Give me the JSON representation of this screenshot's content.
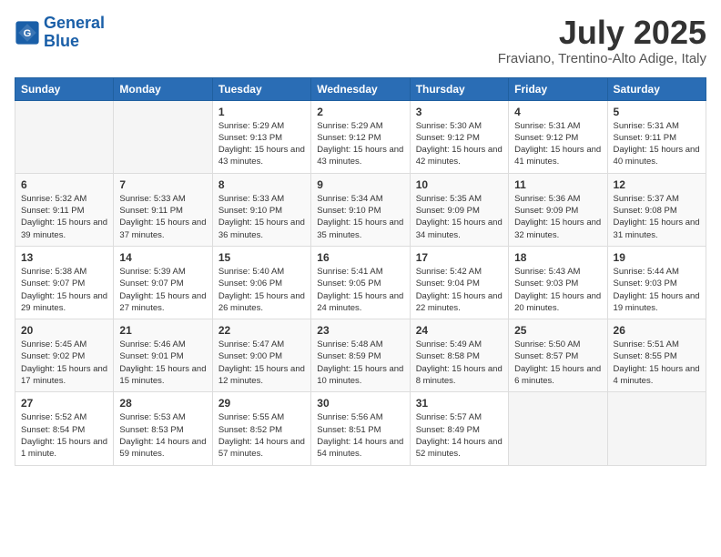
{
  "header": {
    "logo_general": "General",
    "logo_blue": "Blue",
    "month_year": "July 2025",
    "location": "Fraviano, Trentino-Alto Adige, Italy"
  },
  "columns": [
    "Sunday",
    "Monday",
    "Tuesday",
    "Wednesday",
    "Thursday",
    "Friday",
    "Saturday"
  ],
  "weeks": [
    [
      {
        "day": "",
        "info": ""
      },
      {
        "day": "",
        "info": ""
      },
      {
        "day": "1",
        "info": "Sunrise: 5:29 AM\nSunset: 9:13 PM\nDaylight: 15 hours\nand 43 minutes."
      },
      {
        "day": "2",
        "info": "Sunrise: 5:29 AM\nSunset: 9:12 PM\nDaylight: 15 hours\nand 43 minutes."
      },
      {
        "day": "3",
        "info": "Sunrise: 5:30 AM\nSunset: 9:12 PM\nDaylight: 15 hours\nand 42 minutes."
      },
      {
        "day": "4",
        "info": "Sunrise: 5:31 AM\nSunset: 9:12 PM\nDaylight: 15 hours\nand 41 minutes."
      },
      {
        "day": "5",
        "info": "Sunrise: 5:31 AM\nSunset: 9:11 PM\nDaylight: 15 hours\nand 40 minutes."
      }
    ],
    [
      {
        "day": "6",
        "info": "Sunrise: 5:32 AM\nSunset: 9:11 PM\nDaylight: 15 hours\nand 39 minutes."
      },
      {
        "day": "7",
        "info": "Sunrise: 5:33 AM\nSunset: 9:11 PM\nDaylight: 15 hours\nand 37 minutes."
      },
      {
        "day": "8",
        "info": "Sunrise: 5:33 AM\nSunset: 9:10 PM\nDaylight: 15 hours\nand 36 minutes."
      },
      {
        "day": "9",
        "info": "Sunrise: 5:34 AM\nSunset: 9:10 PM\nDaylight: 15 hours\nand 35 minutes."
      },
      {
        "day": "10",
        "info": "Sunrise: 5:35 AM\nSunset: 9:09 PM\nDaylight: 15 hours\nand 34 minutes."
      },
      {
        "day": "11",
        "info": "Sunrise: 5:36 AM\nSunset: 9:09 PM\nDaylight: 15 hours\nand 32 minutes."
      },
      {
        "day": "12",
        "info": "Sunrise: 5:37 AM\nSunset: 9:08 PM\nDaylight: 15 hours\nand 31 minutes."
      }
    ],
    [
      {
        "day": "13",
        "info": "Sunrise: 5:38 AM\nSunset: 9:07 PM\nDaylight: 15 hours\nand 29 minutes."
      },
      {
        "day": "14",
        "info": "Sunrise: 5:39 AM\nSunset: 9:07 PM\nDaylight: 15 hours\nand 27 minutes."
      },
      {
        "day": "15",
        "info": "Sunrise: 5:40 AM\nSunset: 9:06 PM\nDaylight: 15 hours\nand 26 minutes."
      },
      {
        "day": "16",
        "info": "Sunrise: 5:41 AM\nSunset: 9:05 PM\nDaylight: 15 hours\nand 24 minutes."
      },
      {
        "day": "17",
        "info": "Sunrise: 5:42 AM\nSunset: 9:04 PM\nDaylight: 15 hours\nand 22 minutes."
      },
      {
        "day": "18",
        "info": "Sunrise: 5:43 AM\nSunset: 9:03 PM\nDaylight: 15 hours\nand 20 minutes."
      },
      {
        "day": "19",
        "info": "Sunrise: 5:44 AM\nSunset: 9:03 PM\nDaylight: 15 hours\nand 19 minutes."
      }
    ],
    [
      {
        "day": "20",
        "info": "Sunrise: 5:45 AM\nSunset: 9:02 PM\nDaylight: 15 hours\nand 17 minutes."
      },
      {
        "day": "21",
        "info": "Sunrise: 5:46 AM\nSunset: 9:01 PM\nDaylight: 15 hours\nand 15 minutes."
      },
      {
        "day": "22",
        "info": "Sunrise: 5:47 AM\nSunset: 9:00 PM\nDaylight: 15 hours\nand 12 minutes."
      },
      {
        "day": "23",
        "info": "Sunrise: 5:48 AM\nSunset: 8:59 PM\nDaylight: 15 hours\nand 10 minutes."
      },
      {
        "day": "24",
        "info": "Sunrise: 5:49 AM\nSunset: 8:58 PM\nDaylight: 15 hours\nand 8 minutes."
      },
      {
        "day": "25",
        "info": "Sunrise: 5:50 AM\nSunset: 8:57 PM\nDaylight: 15 hours\nand 6 minutes."
      },
      {
        "day": "26",
        "info": "Sunrise: 5:51 AM\nSunset: 8:55 PM\nDaylight: 15 hours\nand 4 minutes."
      }
    ],
    [
      {
        "day": "27",
        "info": "Sunrise: 5:52 AM\nSunset: 8:54 PM\nDaylight: 15 hours\nand 1 minute."
      },
      {
        "day": "28",
        "info": "Sunrise: 5:53 AM\nSunset: 8:53 PM\nDaylight: 14 hours\nand 59 minutes."
      },
      {
        "day": "29",
        "info": "Sunrise: 5:55 AM\nSunset: 8:52 PM\nDaylight: 14 hours\nand 57 minutes."
      },
      {
        "day": "30",
        "info": "Sunrise: 5:56 AM\nSunset: 8:51 PM\nDaylight: 14 hours\nand 54 minutes."
      },
      {
        "day": "31",
        "info": "Sunrise: 5:57 AM\nSunset: 8:49 PM\nDaylight: 14 hours\nand 52 minutes."
      },
      {
        "day": "",
        "info": ""
      },
      {
        "day": "",
        "info": ""
      }
    ]
  ]
}
